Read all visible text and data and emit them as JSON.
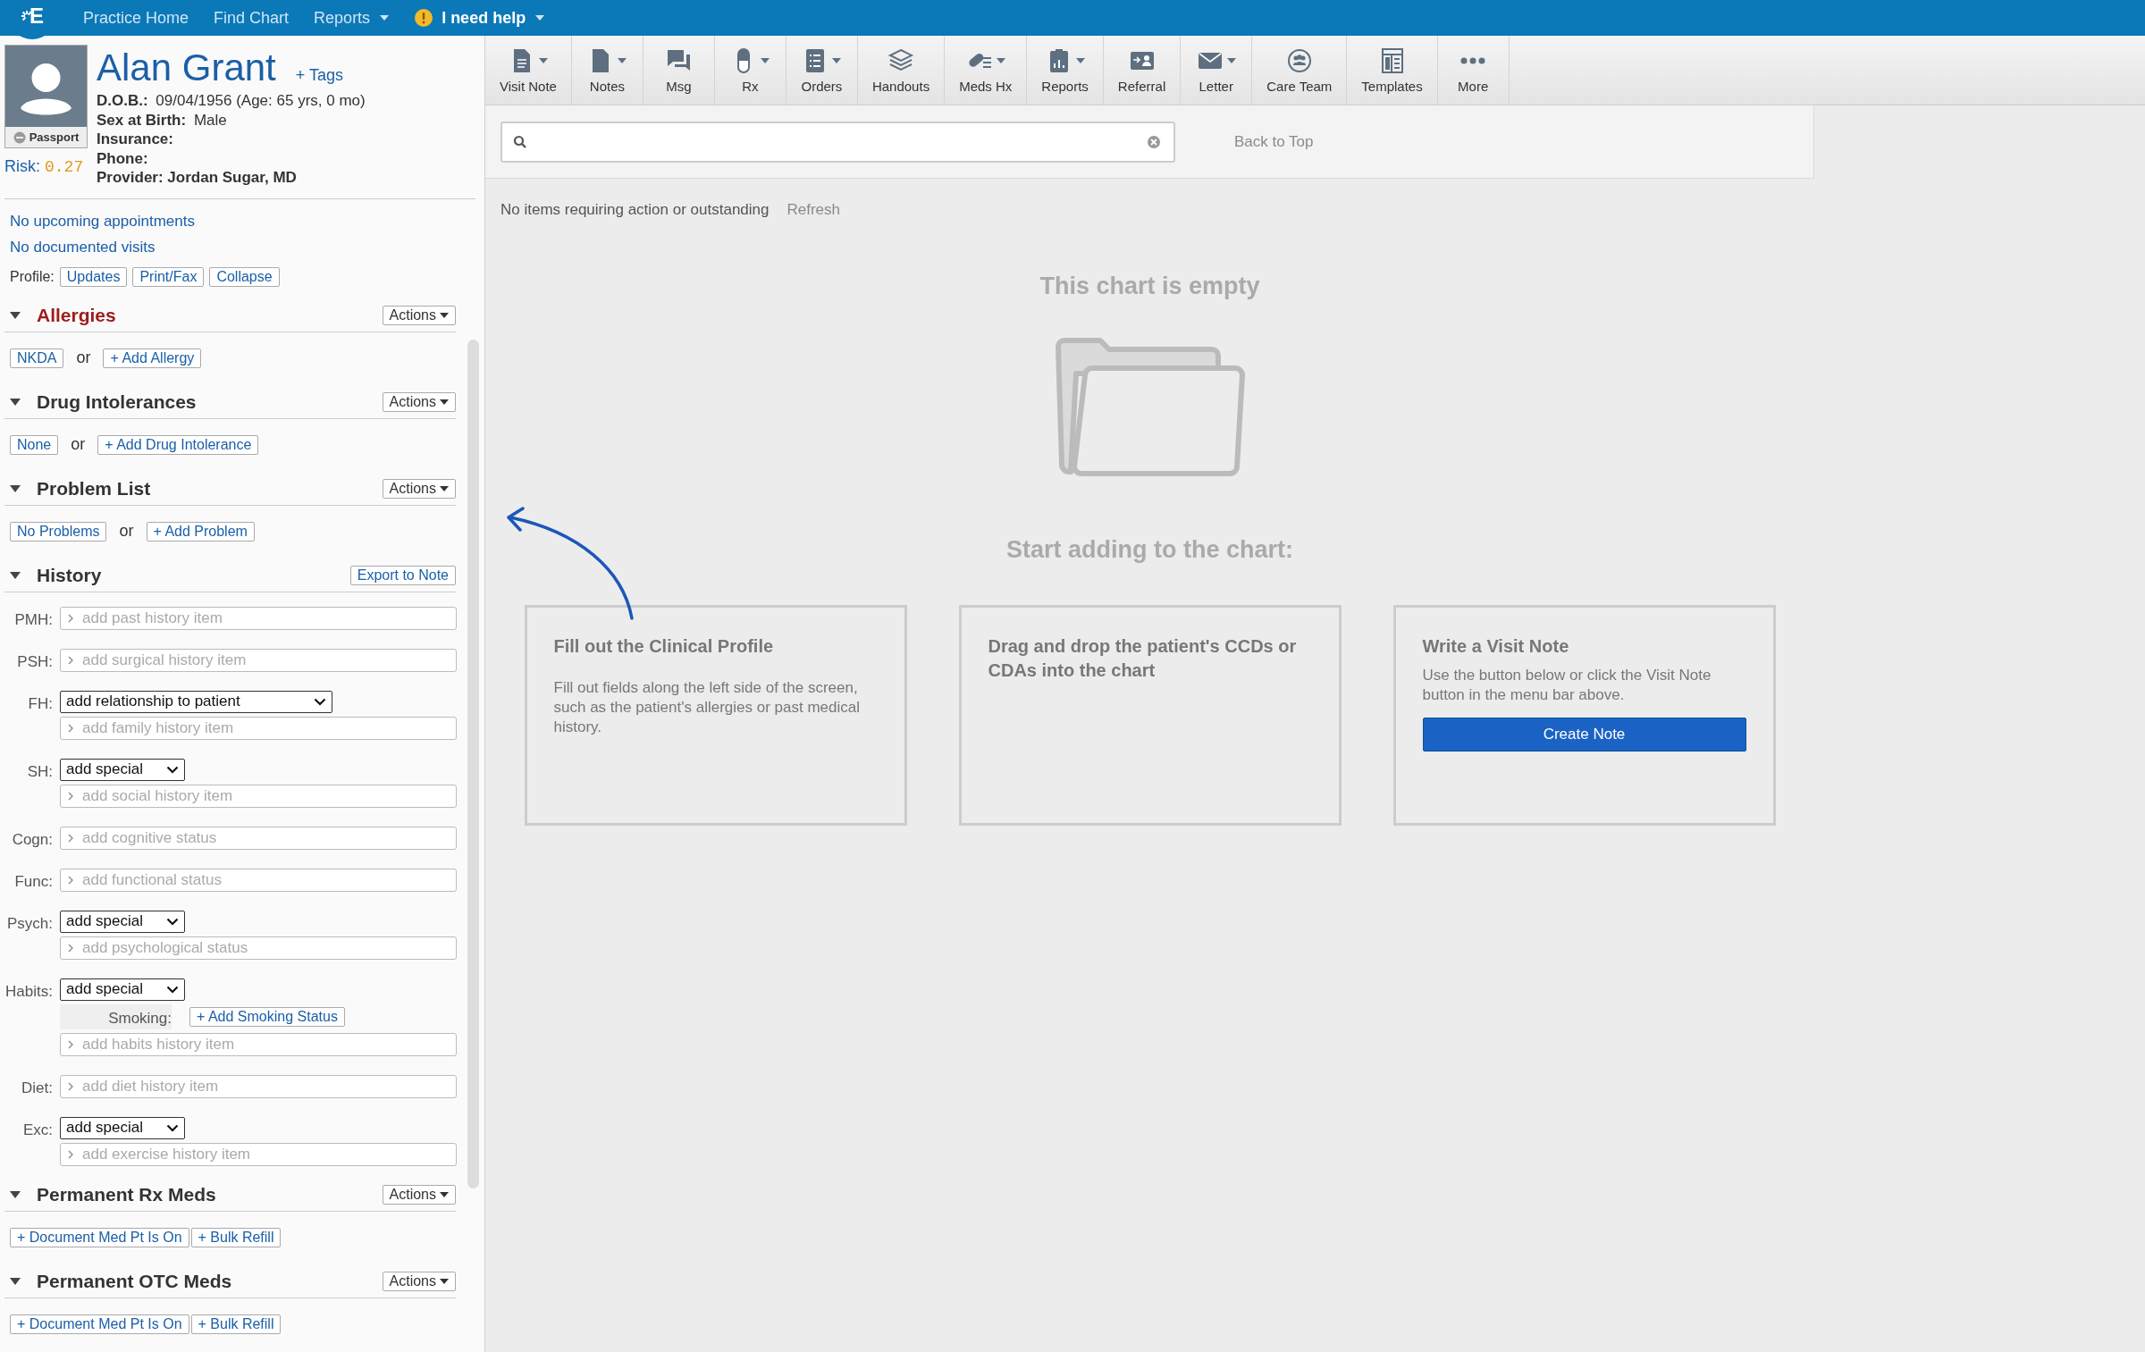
{
  "nav": {
    "logo_text": "E",
    "items": [
      {
        "label": "Practice Home",
        "menu": false,
        "kind": "link"
      },
      {
        "label": "Find Chart",
        "menu": false,
        "kind": "link"
      },
      {
        "label": "Reports",
        "menu": true,
        "kind": "link"
      },
      {
        "label": "I need help",
        "menu": true,
        "kind": "help"
      }
    ]
  },
  "patient": {
    "name": "Alan Grant",
    "tags": "+ Tags",
    "passport": "Passport",
    "risk_label": "Risk:",
    "risk_value": "0.27",
    "details": [
      {
        "label": "D.O.B.:",
        "value": "09/04/1956 (Age: 65 yrs, 0 mo)"
      },
      {
        "label": "Sex at Birth:",
        "value": "Male"
      },
      {
        "label": "Insurance:"
      },
      {
        "label": "Phone:"
      },
      {
        "label": "Provider: Jordan Sugar, MD"
      }
    ],
    "links": [
      "No upcoming appointments",
      "No documented visits"
    ],
    "profile": {
      "label": "Profile:",
      "buttons": [
        "Updates",
        "Print/Fax",
        "Collapse"
      ]
    }
  },
  "sections": [
    {
      "title": "Allergies",
      "alert": true,
      "expanded": true,
      "action": {
        "label": "Actions",
        "menu": true
      },
      "items": [
        {
          "kind": "button",
          "label": "NKDA"
        },
        {
          "kind": "text",
          "label": "or"
        },
        {
          "kind": "button",
          "label": "+ Add Allergy"
        }
      ]
    },
    {
      "title": "Drug Intolerances",
      "alert": false,
      "expanded": true,
      "action": {
        "label": "Actions",
        "menu": true
      },
      "items": [
        {
          "kind": "button",
          "label": "None"
        },
        {
          "kind": "text",
          "label": "or"
        },
        {
          "kind": "button",
          "label": "+ Add Drug Intolerance"
        }
      ]
    },
    {
      "title": "Problem List",
      "alert": false,
      "expanded": true,
      "action": {
        "label": "Actions",
        "menu": true
      },
      "items": [
        {
          "kind": "button",
          "label": "No Problems"
        },
        {
          "kind": "text",
          "label": "or"
        },
        {
          "kind": "button",
          "label": "+ Add Problem"
        }
      ]
    },
    {
      "title": "History",
      "alert": false,
      "expanded": true,
      "action": {
        "label": "Export to Note",
        "menu": false
      },
      "rows": [
        {
          "label": "PMH:",
          "fields": [
            {
              "kind": "input",
              "placeholder": "add past history item"
            }
          ]
        },
        {
          "label": "PSH:",
          "fields": [
            {
              "kind": "input",
              "placeholder": "add surgical history item"
            }
          ]
        },
        {
          "label": "FH:",
          "fields": [
            {
              "kind": "select",
              "value": "add relationship to patient"
            },
            {
              "kind": "input",
              "placeholder": "add family history item"
            }
          ]
        },
        {
          "label": "SH:",
          "fields": [
            {
              "kind": "select",
              "value": "add special"
            },
            {
              "kind": "input",
              "placeholder": "add social history item"
            }
          ]
        },
        {
          "label": "Cogn:",
          "fields": [
            {
              "kind": "input",
              "placeholder": "add cognitive status"
            }
          ]
        },
        {
          "label": "Func:",
          "fields": [
            {
              "kind": "input",
              "placeholder": "add functional status"
            }
          ]
        },
        {
          "label": "Psych:",
          "fields": [
            {
              "kind": "select",
              "value": "add special"
            },
            {
              "kind": "input",
              "placeholder": "add psychological status"
            }
          ]
        },
        {
          "label": "Habits:",
          "fields": [
            {
              "kind": "select",
              "value": "add special"
            },
            {
              "kind": "smoking",
              "label": "Smoking:",
              "button": "+ Add Smoking Status"
            },
            {
              "kind": "input",
              "placeholder": "add habits history item"
            }
          ]
        },
        {
          "label": "Diet:",
          "fields": [
            {
              "kind": "input",
              "placeholder": "add diet history item"
            }
          ]
        },
        {
          "label": "Exc:",
          "fields": [
            {
              "kind": "select",
              "value": "add special"
            },
            {
              "kind": "input",
              "placeholder": "add exercise history item"
            }
          ]
        }
      ]
    },
    {
      "title": "Permanent Rx Meds",
      "alert": false,
      "expanded": true,
      "action": {
        "label": "Actions",
        "menu": true
      },
      "items": [
        {
          "kind": "button",
          "label": "+ Document Med Pt Is On"
        },
        {
          "kind": "button",
          "label": "+ Bulk Refill"
        }
      ]
    },
    {
      "title": "Permanent OTC Meds",
      "alert": false,
      "expanded": true,
      "action": {
        "label": "Actions",
        "menu": true
      },
      "items": [
        {
          "kind": "button",
          "label": "+ Document Med Pt Is On"
        },
        {
          "kind": "button",
          "label": "+ Bulk Refill"
        }
      ]
    }
  ],
  "toolbar": [
    {
      "label": "Visit Note",
      "kind": "note",
      "menu": true
    },
    {
      "label": "Notes",
      "kind": "page",
      "menu": true
    },
    {
      "label": "Msg",
      "kind": "chat",
      "menu": false
    },
    {
      "label": "Rx",
      "kind": "pill",
      "menu": true
    },
    {
      "label": "Orders",
      "kind": "list",
      "menu": true
    },
    {
      "label": "Handouts",
      "kind": "stack",
      "menu": false
    },
    {
      "label": "Meds Hx",
      "kind": "meds",
      "menu": true
    },
    {
      "label": "Reports",
      "kind": "clipboard",
      "menu": true
    },
    {
      "label": "Referral",
      "kind": "referral",
      "menu": false
    },
    {
      "label": "Letter",
      "kind": "mail",
      "menu": true
    },
    {
      "label": "Care Team",
      "kind": "team",
      "menu": false
    },
    {
      "label": "Templates",
      "kind": "template",
      "menu": false
    },
    {
      "label": "More",
      "kind": "dots",
      "menu": false
    }
  ],
  "search": {
    "back_to_top": "Back to Top"
  },
  "status": {
    "message": "No items requiring action or outstanding",
    "refresh": "Refresh"
  },
  "empty_state": {
    "title": "This chart is empty",
    "subtitle": "Start adding to the chart:",
    "cards": [
      {
        "title": "Fill out the Clinical Profile",
        "body": "Fill out fields along the left side of the screen, such as the patient's allergies or past medical history."
      },
      {
        "title": "Drag and drop the patient's CCDs or CDAs into the chart"
      },
      {
        "title": "Write a Visit Note",
        "body": "Use the button below or click the Visit Note button in the menu bar above.",
        "button": "Create Note"
      }
    ]
  }
}
